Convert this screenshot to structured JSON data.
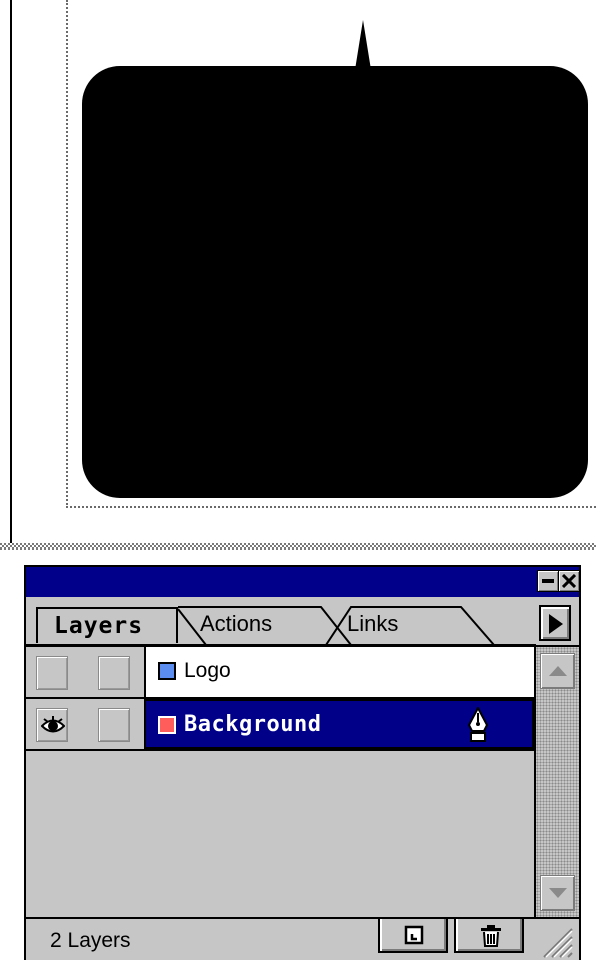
{
  "palette": {
    "tabs": [
      {
        "label": "Layers",
        "active": true
      },
      {
        "label": "Actions",
        "active": false
      },
      {
        "label": "Links",
        "active": false
      }
    ],
    "layers": [
      {
        "name": "Logo",
        "color": "#5b8cf0",
        "visible": false,
        "selected": false
      },
      {
        "name": "Background",
        "color": "#ff5c5c",
        "visible": true,
        "selected": true
      }
    ],
    "status": {
      "layer_count": "2 Layers"
    },
    "colors": {
      "titlebar": "#00008a",
      "selection": "#000088",
      "face": "#c6c6c6"
    },
    "icons": {
      "visibility": "eye-icon",
      "current_layer": "pen-icon",
      "new_layer": "new-layer-icon",
      "delete": "trash-icon"
    }
  }
}
